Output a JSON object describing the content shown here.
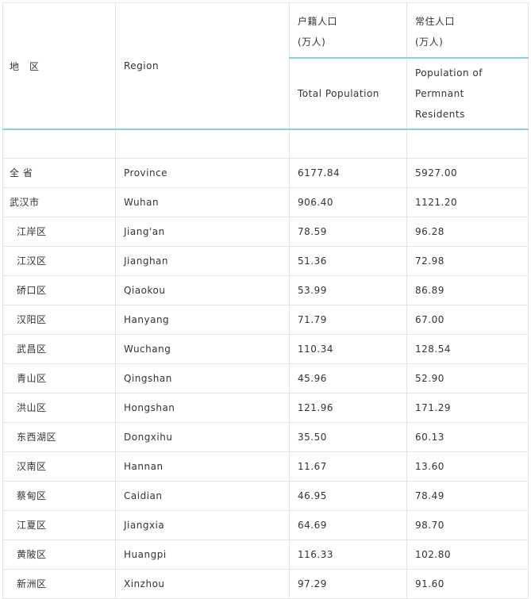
{
  "header": {
    "region_zh": "地　区",
    "region_en": "Region",
    "total_zh_line1": "户籍人口",
    "total_zh_line2": "(万人)",
    "total_en": "Total Population",
    "resident_zh_line1": "常住人口",
    "resident_zh_line2": "(万人)",
    "resident_en": "Population of Permnant Residents"
  },
  "rows": [
    {
      "zh": "全 省",
      "en": "Province",
      "total": "6177.84",
      "resident": "5927.00",
      "level": "top"
    },
    {
      "zh": "武汉市",
      "en": "Wuhan",
      "total": "906.40",
      "resident": "1121.20",
      "level": "top"
    },
    {
      "zh": "江岸区",
      "en": "Jiang'an",
      "total": "78.59",
      "resident": "96.28",
      "level": "sub"
    },
    {
      "zh": "江汉区",
      "en": "Jianghan",
      "total": "51.36",
      "resident": "72.98",
      "level": "sub"
    },
    {
      "zh": "硚口区",
      "en": "Qiaokou",
      "total": "53.99",
      "resident": "86.89",
      "level": "sub"
    },
    {
      "zh": "汉阳区",
      "en": "Hanyang",
      "total": "71.79",
      "resident": "67.00",
      "level": "sub"
    },
    {
      "zh": "武昌区",
      "en": "Wuchang",
      "total": "110.34",
      "resident": "128.54",
      "level": "sub"
    },
    {
      "zh": "青山区",
      "en": "Qingshan",
      "total": "45.96",
      "resident": "52.90",
      "level": "sub"
    },
    {
      "zh": "洪山区",
      "en": "Hongshan",
      "total": "121.96",
      "resident": "171.29",
      "level": "sub"
    },
    {
      "zh": "东西湖区",
      "en": "Dongxihu",
      "total": "35.50",
      "resident": "60.13",
      "level": "sub"
    },
    {
      "zh": "汉南区",
      "en": "Hannan",
      "total": "11.67",
      "resident": "13.60",
      "level": "sub"
    },
    {
      "zh": "蔡甸区",
      "en": "Caidian",
      "total": "46.95",
      "resident": "78.49",
      "level": "sub"
    },
    {
      "zh": "江夏区",
      "en": "Jiangxia",
      "total": "64.69",
      "resident": "98.70",
      "level": "sub"
    },
    {
      "zh": "黄陂区",
      "en": "Huangpi",
      "total": "116.33",
      "resident": "102.80",
      "level": "sub"
    },
    {
      "zh": "新洲区",
      "en": "Xinzhou",
      "total": "97.29",
      "resident": "91.60",
      "level": "sub"
    }
  ]
}
